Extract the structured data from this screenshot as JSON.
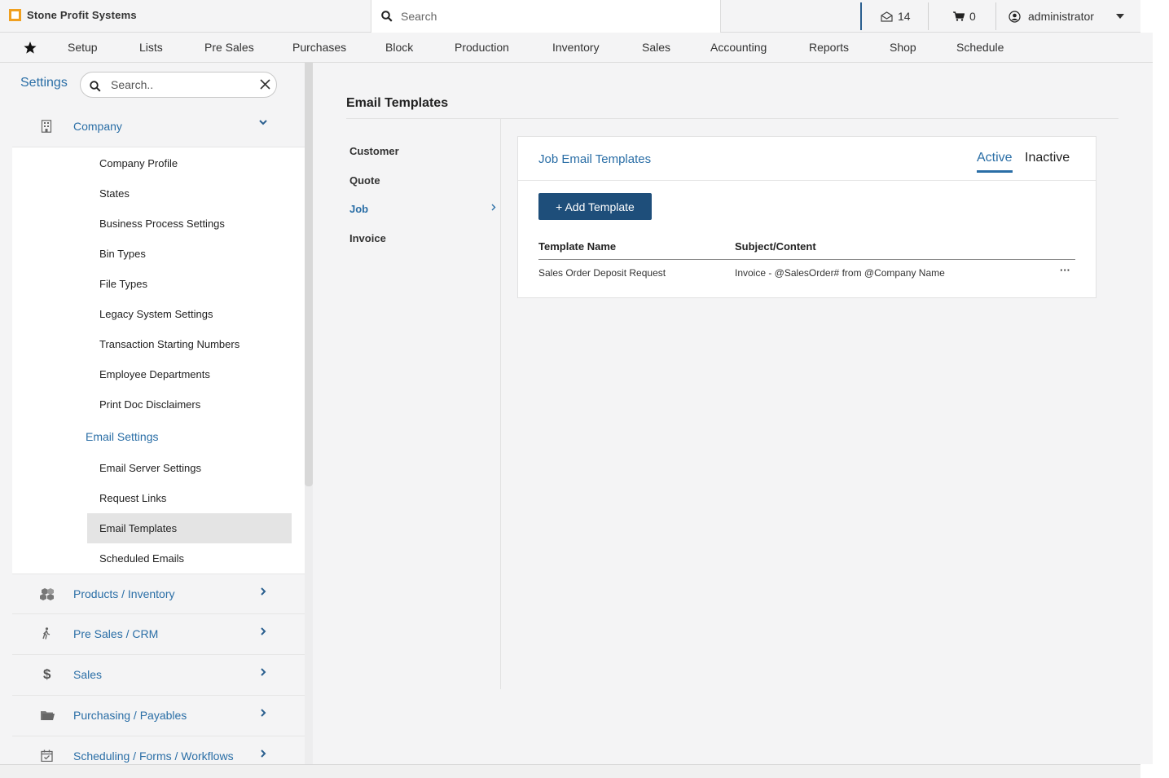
{
  "app": {
    "brand": "Stone Profit Systems"
  },
  "topbar": {
    "search_placeholder": "Search",
    "messages_count": "14",
    "cart_count": "0",
    "user": "administrator"
  },
  "nav": {
    "items": [
      "Setup",
      "Lists",
      "Pre Sales",
      "Purchases",
      "Block",
      "Production",
      "Inventory",
      "Sales",
      "Accounting",
      "Reports",
      "Shop",
      "Schedule"
    ]
  },
  "sidebar": {
    "title": "Settings",
    "search_placeholder": "Search..",
    "company": {
      "label": "Company",
      "items": [
        "Company Profile",
        "States",
        "Business Process Settings",
        "Bin Types",
        "File Types",
        "Legacy System Settings",
        "Transaction Starting Numbers",
        "Employee Departments",
        "Print Doc Disclaimers"
      ],
      "email_group": "Email Settings",
      "email_items": [
        "Email Server Settings",
        "Request Links",
        "Email Templates",
        "Scheduled Emails"
      ],
      "active_item": "Email Templates"
    },
    "sections": [
      "Products / Inventory",
      "Pre Sales / CRM",
      "Sales",
      "Purchasing / Payables",
      "Scheduling / Forms / Workflows"
    ]
  },
  "main": {
    "title": "Email Templates",
    "subnav": [
      "Customer",
      "Quote",
      "Job",
      "Invoice"
    ],
    "subnav_active": "Job",
    "card": {
      "title": "Job Email Templates",
      "tab_active": "Active",
      "tab_inactive": "Inactive",
      "add_button": "+ Add Template",
      "columns": [
        "Template Name",
        "Subject/Content"
      ],
      "rows": [
        {
          "name": "Sales Order Deposit Request",
          "subject": "Invoice - @SalesOrder# from @Company Name",
          "menu": "···"
        }
      ]
    }
  },
  "colors": {
    "accent": "#2a6ea6",
    "button": "#1e4e7a",
    "brand_logo": "#f0a020"
  }
}
